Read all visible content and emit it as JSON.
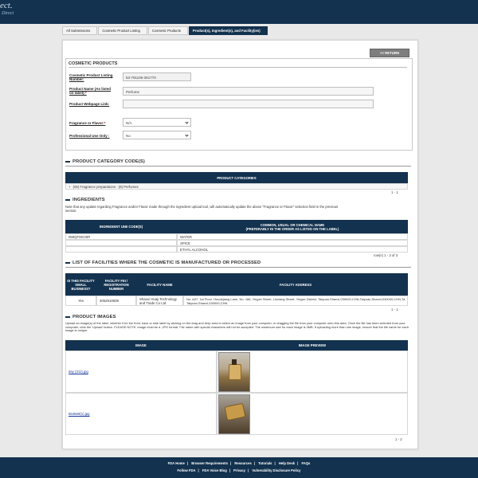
{
  "header": {
    "logo_line1": "ect.",
    "logo_line2": "Direct"
  },
  "breadcrumb": [
    "All Submissions",
    "Cosmetic Product Listing",
    "Cosmetic Products",
    "Product(s), Ingredient(s), and Facility(ies)"
  ],
  "return_button": "<< RETURN",
  "cosmetic_products": {
    "title": "COSMETIC PRODUCTS",
    "listing_number_label": "Cosmetic Product Listing Number:",
    "listing_number_value": "53-791106-391770",
    "product_name_label": "Product Name (As listed on label):",
    "product_name_value": "Perfume",
    "webpage_label": "Product Webpage Link:",
    "webpage_value": "",
    "fragrance_label": "Fragrance or Flavor:",
    "fragrance_value": "N/A",
    "professional_label": "Professional Use Only :",
    "professional_value": "No"
  },
  "category": {
    "section_title": "PRODUCT CATEGORY CODE(S)",
    "header": "PRODUCT CATEGORIES",
    "row": "(05) Fragrance preparations - (8) Perfumes",
    "pager": "1 - 1"
  },
  "ingredients": {
    "section_title": "INGREDIENTS",
    "note": "Note that any update regarding Fragrance and/or Flavor made through the ingredient upload tool, will automatically update the above \"Fragrance or Flavor\" selection field in the previous section.",
    "col1": "INGREDIENT UNII CODE(S)",
    "col2_line1": "COMMON, USUAL OR CHEMICAL NAME",
    "col2_line2": "(PREFERABLY IN THE ORDER AS LISTED ON THE LABEL)",
    "rows": [
      {
        "code": "059QF0KO0R",
        "name": "WATER"
      },
      {
        "code": "",
        "name": "SPICE"
      },
      {
        "code": "",
        "name": "ETHYL ALCOHOL"
      }
    ],
    "pager": "row(s) 1 - 3 of 3"
  },
  "facilities": {
    "section_title": "LIST OF FACILITIES WHERE THE COSMETIC IS MANUFACTURED OR PROCESSED",
    "col1": "IS THIS FACILITY SMALL BUSINESS?",
    "col2": "FACILITY FEI / REGISTRATION NUMBER",
    "col3": "FACILITY NAME",
    "col4": "FACILITY ADDRESS",
    "row": {
      "small": "Yes",
      "fei": "3052910839",
      "name": "Shaoxi Huaji Technology and Trade Co Ltd",
      "address": "No. A07, 1st Floor, Houdejiang Lane, No. 188, Yingze Street, Liuxiang Street, Yingze District, Taiyuan,Shanxi,030000,CHN,Taiyuan,Shanxi,030000,CHN,Ta Taiyuan,Shanxi,030000,CHN"
    },
    "pager": "1 - 1"
  },
  "images": {
    "section_title": "PRODUCT IMAGES",
    "note": "Upload an image(s) of the label, whether it be the front, back or side label by clicking on the drag and drop area to select an image from your computer, or dragging the file from your computer onto this area. Once the file has been selected from your computer, click the 'Upload' button. PLEASE NOTE: Image must be a .JPG format. File name with special characters will not be accepted. The maximum size for each image is 3MB. If uploading more than one image, ensure that the file name for each image is unique.",
    "col1": "IMAGE",
    "col2": "IMAGE PREVIEW",
    "rows": [
      {
        "file": "day (311).jpg"
      },
      {
        "file": "564569(1).jpg"
      }
    ],
    "pager": "1 - 2"
  },
  "footer": {
    "row1": [
      "FDA Home",
      "Browser Requirements",
      "Resources",
      "Tutorials",
      "Help Desk",
      "FAQs"
    ],
    "row2": [
      "Follow FDA",
      "FDA Voice Blog",
      "Privacy",
      "Vulnerability Disclosure Policy"
    ]
  }
}
